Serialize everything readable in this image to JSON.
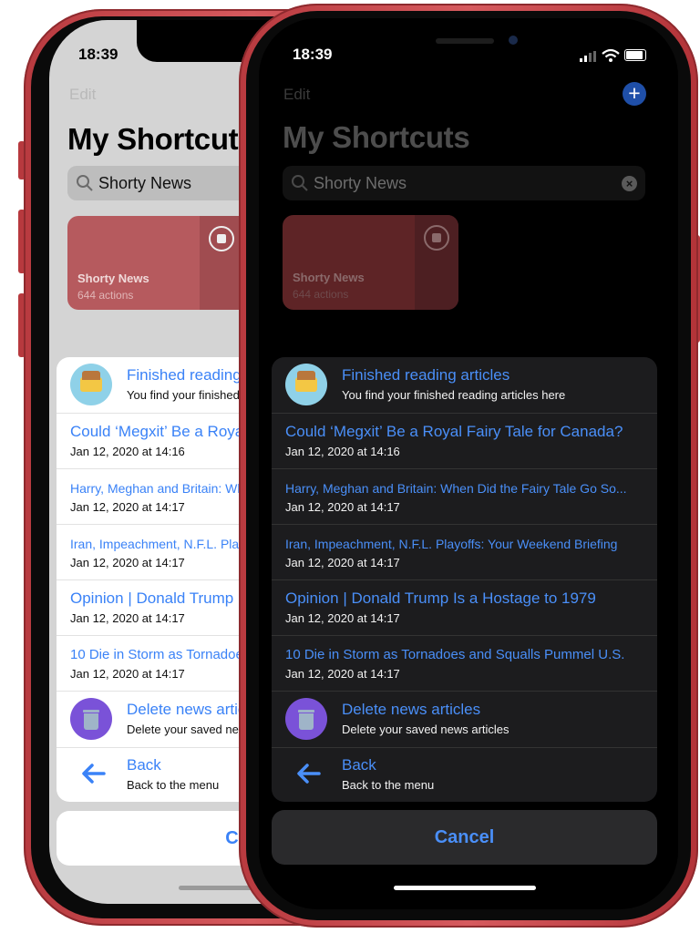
{
  "status": {
    "time": "18:39"
  },
  "nav": {
    "edit_label": "Edit",
    "add_icon": "plus-circle-icon"
  },
  "page": {
    "title": "My Shortcuts"
  },
  "search": {
    "value": "Shorty News"
  },
  "shortcut": {
    "name": "Shorty News",
    "actions": "644 actions",
    "color": "#b14a4f"
  },
  "menu": {
    "finished": {
      "title": "Finished reading articles",
      "subtitle": "You find your finished reading articles here",
      "icon": "inbox-tray-icon"
    },
    "articles": [
      {
        "title": "Could ‘Megxit’ Be a Royal Fairy Tale for Canada?",
        "date": "Jan 12, 2020 at 14:16"
      },
      {
        "title": "Harry, Meghan and Britain: When Did the Fairy Tale Go So...",
        "date": "Jan 12, 2020 at 14:17"
      },
      {
        "title": "Iran, Impeachment, N.F.L. Playoffs: Your Weekend Briefing",
        "date": "Jan 12, 2020 at 14:17"
      },
      {
        "title": "Opinion | Donald Trump Is a Hostage to 1979",
        "date": "Jan 12, 2020 at 14:17"
      },
      {
        "title": "10 Die in Storm as Tornadoes and Squalls Pummel U.S.",
        "date": "Jan 12, 2020 at 14:17"
      }
    ],
    "delete": {
      "title": "Delete news articles",
      "subtitle": "Delete your saved news articles",
      "icon": "trash-icon"
    },
    "back": {
      "title": "Back",
      "subtitle": "Back to the menu",
      "icon": "arrow-left-icon"
    }
  },
  "cancel_label": "Cancel",
  "colors": {
    "link_blue": "#3a82f7",
    "dark_link_blue": "#4a8ff8",
    "phone_red": "#c0444a"
  }
}
